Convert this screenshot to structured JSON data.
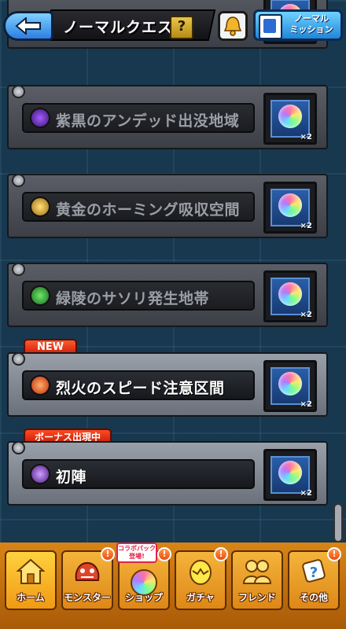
{
  "header": {
    "title": "ノーマルクエスト",
    "help_label": "?",
    "mission_line1": "ノーマル",
    "mission_line2": "ミッション"
  },
  "stages": [
    {
      "name": "",
      "reward": "×2",
      "state": "locked"
    },
    {
      "name": "紫黒のアンデッド出没地域",
      "reward": "×2",
      "state": "locked",
      "element": "dark"
    },
    {
      "name": "黄金のホーミング吸収空間",
      "reward": "×2",
      "state": "locked",
      "element": "light"
    },
    {
      "name": "緑陵のサソリ発生地帯",
      "reward": "×2",
      "state": "locked",
      "element": "wood"
    },
    {
      "name": "烈火のスピード注意区間",
      "reward": "×2",
      "state": "active",
      "element": "fire",
      "badge": "NEW"
    },
    {
      "name": "初陣",
      "reward": "×2",
      "state": "active",
      "element": "dark",
      "badge": "ボーナス出現中"
    }
  ],
  "nav": {
    "home": "ホーム",
    "monster": "モンスター",
    "shop": "ショップ",
    "gacha": "ガチャ",
    "friend": "フレンド",
    "other": "その他",
    "alert": "!",
    "collab_line1": "コラボパック",
    "collab_line2": "登場!"
  },
  "colors": {
    "background": "#17384e",
    "nav_bg": "#d88416",
    "accent_blue": "#1f86d8",
    "badge_red": "#c91e0e"
  }
}
